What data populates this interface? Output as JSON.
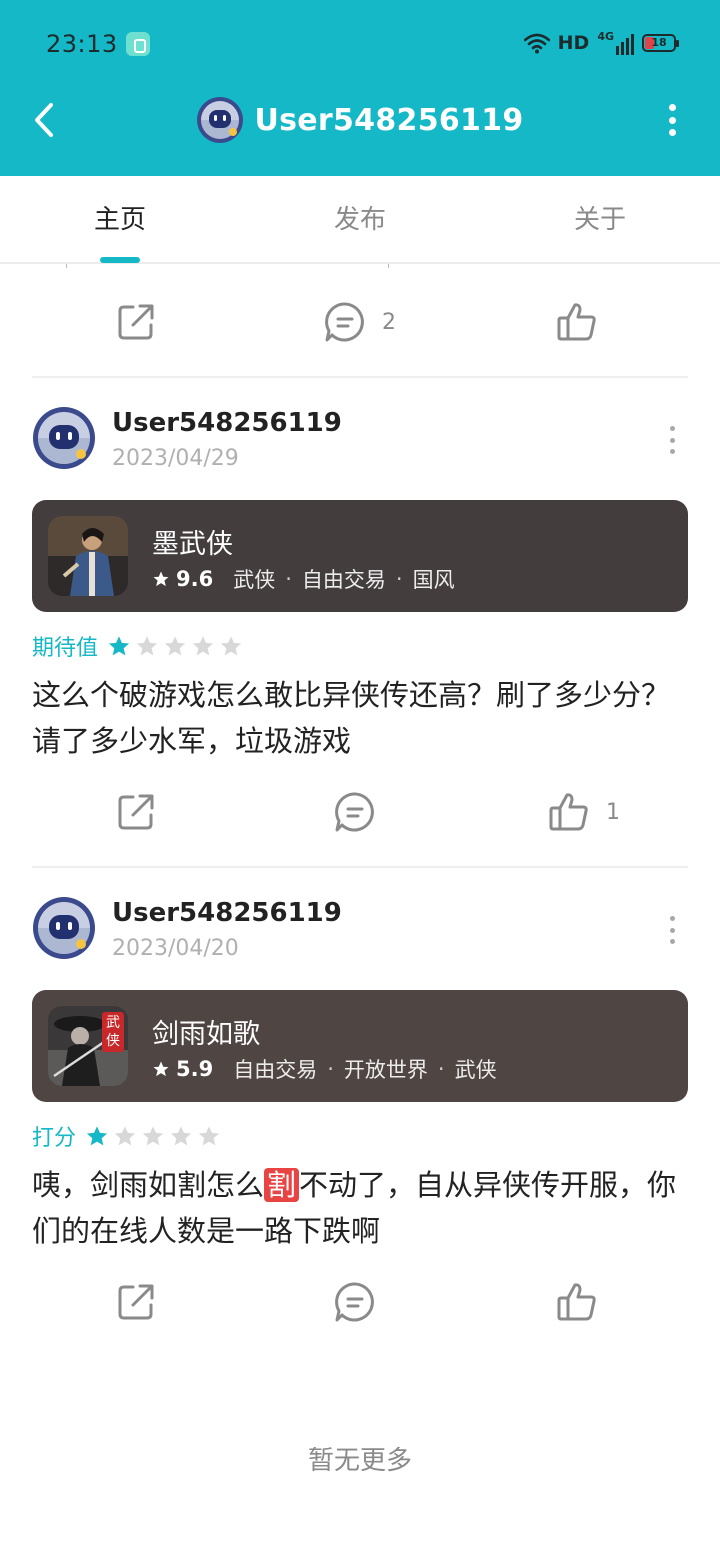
{
  "status_bar": {
    "time": "23:13",
    "network": "HD",
    "network_gen": "4G",
    "battery": "18"
  },
  "header": {
    "title": "User548256119",
    "back_icon": "chevron-left-icon",
    "more_icon": "more-vertical-icon"
  },
  "tabs": [
    {
      "label": "主页",
      "active": true
    },
    {
      "label": "发布",
      "active": false
    },
    {
      "label": "关于",
      "active": false
    }
  ],
  "posts": [
    {
      "comment_count": "2",
      "like_count": ""
    },
    {
      "user": "User548256119",
      "date": "2023/04/29",
      "game": {
        "name": "墨武侠",
        "score": "9.6",
        "tags": [
          "武侠",
          "自由交易",
          "国风"
        ]
      },
      "rating_label": "期待值",
      "stars": 1,
      "text": "这么个破游戏怎么敢比异侠传还高？刷了多少分？请了多少水军，垃圾游戏",
      "comment_count": "",
      "like_count": "1"
    },
    {
      "user": "User548256119",
      "date": "2023/04/20",
      "game": {
        "name": "剑雨如歌",
        "score": "5.9",
        "tags": [
          "自由交易",
          "开放世界",
          "武侠"
        ],
        "thumb_badge": "武侠"
      },
      "rating_label": "打分",
      "stars": 1,
      "text_before": "咦，剑雨如割怎么",
      "text_highlight": "割",
      "text_after": "不动了，自从异侠传开服，你们的在线人数是一路下跌啊",
      "comment_count": "",
      "like_count": ""
    }
  ],
  "footer": {
    "no_more": "暂无更多"
  },
  "colors": {
    "accent": "#15b8c6",
    "card_dark": "#433d3e",
    "card_brown": "#4f4542",
    "star_empty": "#d8d8d8",
    "highlight": "#e84443"
  }
}
